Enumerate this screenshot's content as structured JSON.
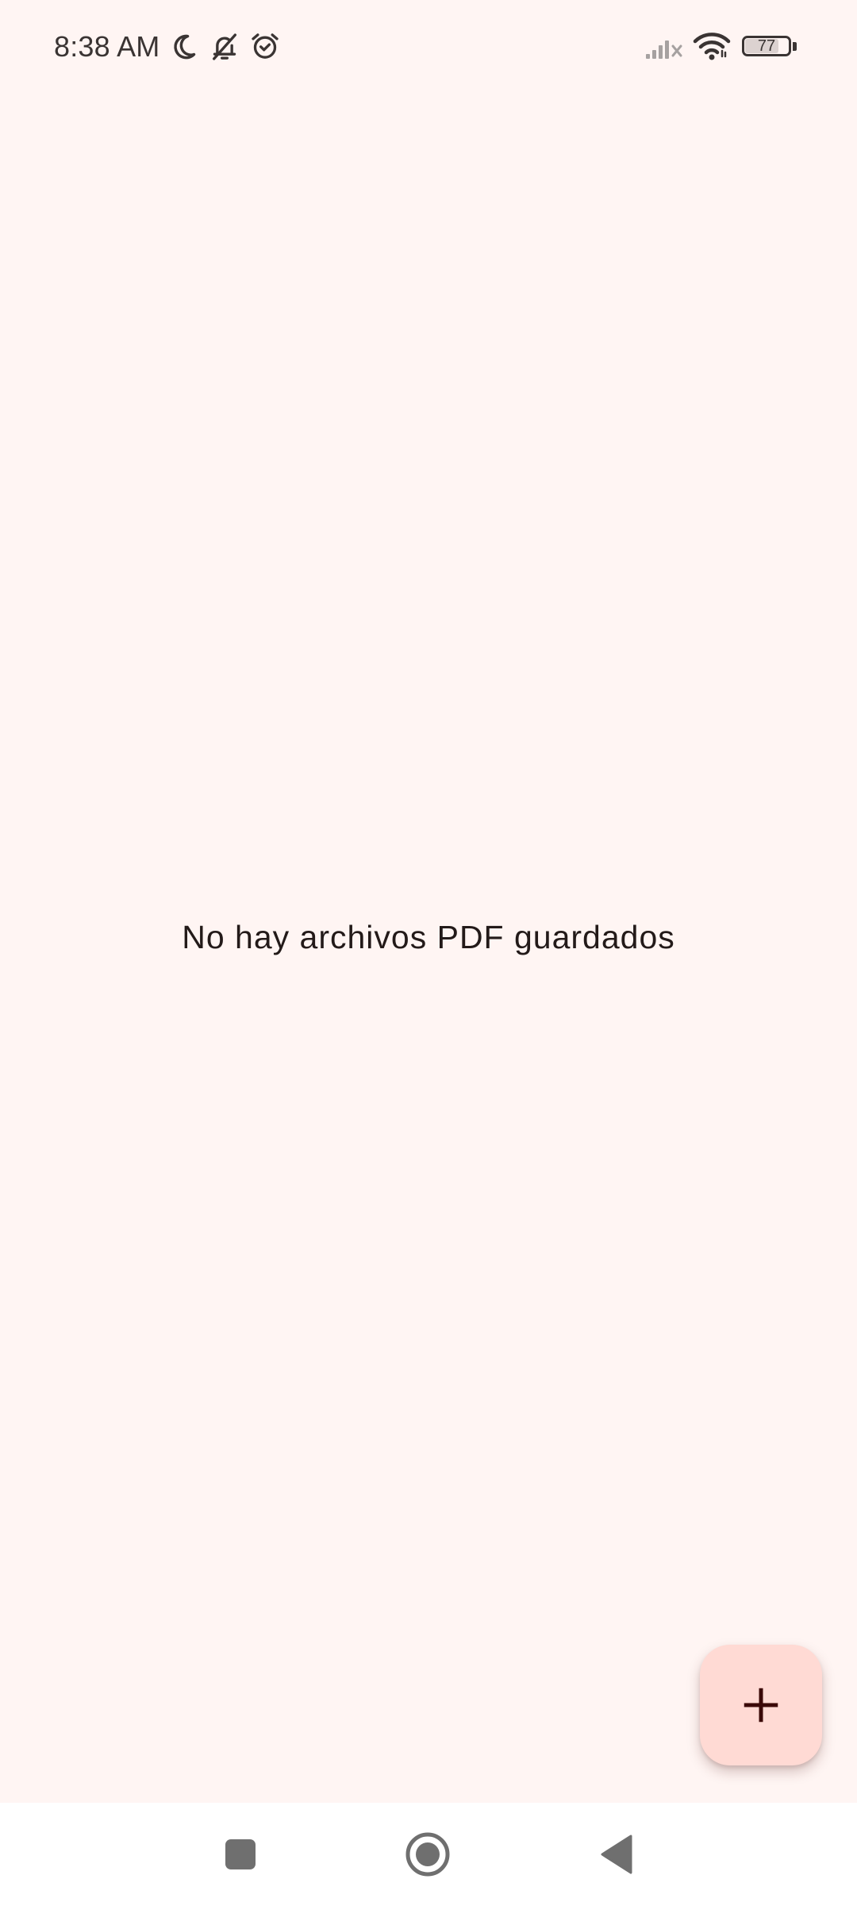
{
  "status_bar": {
    "time": "8:38 AM",
    "battery_level": "77",
    "icons": [
      "moon-icon",
      "bell-off-icon",
      "alarm-icon",
      "signal-no-service-icon",
      "wifi-icon",
      "battery-icon"
    ]
  },
  "main": {
    "empty_message": "No hay archivos PDF guardados"
  },
  "fab": {
    "icon": "plus-icon"
  },
  "nav_bar": {
    "buttons": [
      "recents-button",
      "home-button",
      "back-button"
    ]
  },
  "colors": {
    "background": "#fff5f3",
    "fab_background": "#ffdad4",
    "fab_icon": "#3b0908",
    "text": "#231a19",
    "nav_bar": "#ffffff",
    "nav_icon": "#6f6f6f"
  }
}
